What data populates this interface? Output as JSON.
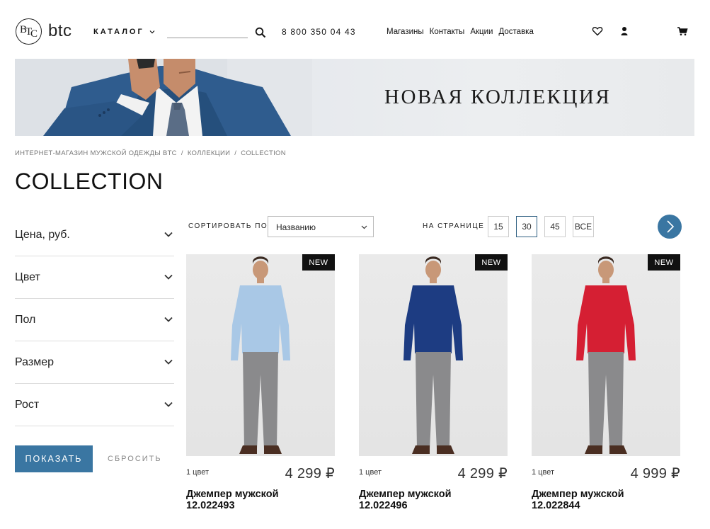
{
  "header": {
    "logo_text": "btc",
    "catalog_label": "КАТАЛОГ",
    "search_value": "",
    "phone": "8 800 350 04 43",
    "nav": [
      "Магазины",
      "Контакты",
      "Акции",
      "Доставка"
    ]
  },
  "banner": {
    "title": "НОВАЯ КОЛЛЕКЦИЯ"
  },
  "breadcrumbs": [
    "ИНТЕРНЕТ-МАГАЗИН МУЖСКОЙ ОДЕЖДЫ BTC",
    "КОЛЛЕКЦИИ",
    "COLLECTION"
  ],
  "page_title": "COLLECTION",
  "filters": [
    "Цена, руб.",
    "Цвет",
    "Пол",
    "Размер",
    "Рост"
  ],
  "filter_actions": {
    "show": "ПОКАЗАТЬ",
    "reset": "СБРОСИТЬ"
  },
  "sort": {
    "label": "СОРТИРОВАТЬ ПО",
    "value": "Названию"
  },
  "per_page": {
    "label": "НА СТРАНИЦЕ",
    "options": [
      "15",
      "30",
      "45",
      "ВСЕ"
    ],
    "selected": "30"
  },
  "products": [
    {
      "badge": "NEW",
      "colors": "1 цвет",
      "price": "4 299 ₽",
      "name": "Джемпер мужской",
      "sku": "12.022493",
      "sweater_color": "#a9c8e6"
    },
    {
      "badge": "NEW",
      "colors": "1 цвет",
      "price": "4 299 ₽",
      "name": "Джемпер мужской",
      "sku": "12.022496",
      "sweater_color": "#1d3c82"
    },
    {
      "badge": "NEW",
      "colors": "1 цвет",
      "price": "4 999 ₽",
      "name": "Джемпер мужской",
      "sku": "12.022844",
      "sweater_color": "#d51f33"
    }
  ],
  "colors": {
    "accent": "#3a76a2",
    "badge_bg": "#111111",
    "trousers": "#8a8a8c",
    "suit": "#2f5c8e"
  }
}
